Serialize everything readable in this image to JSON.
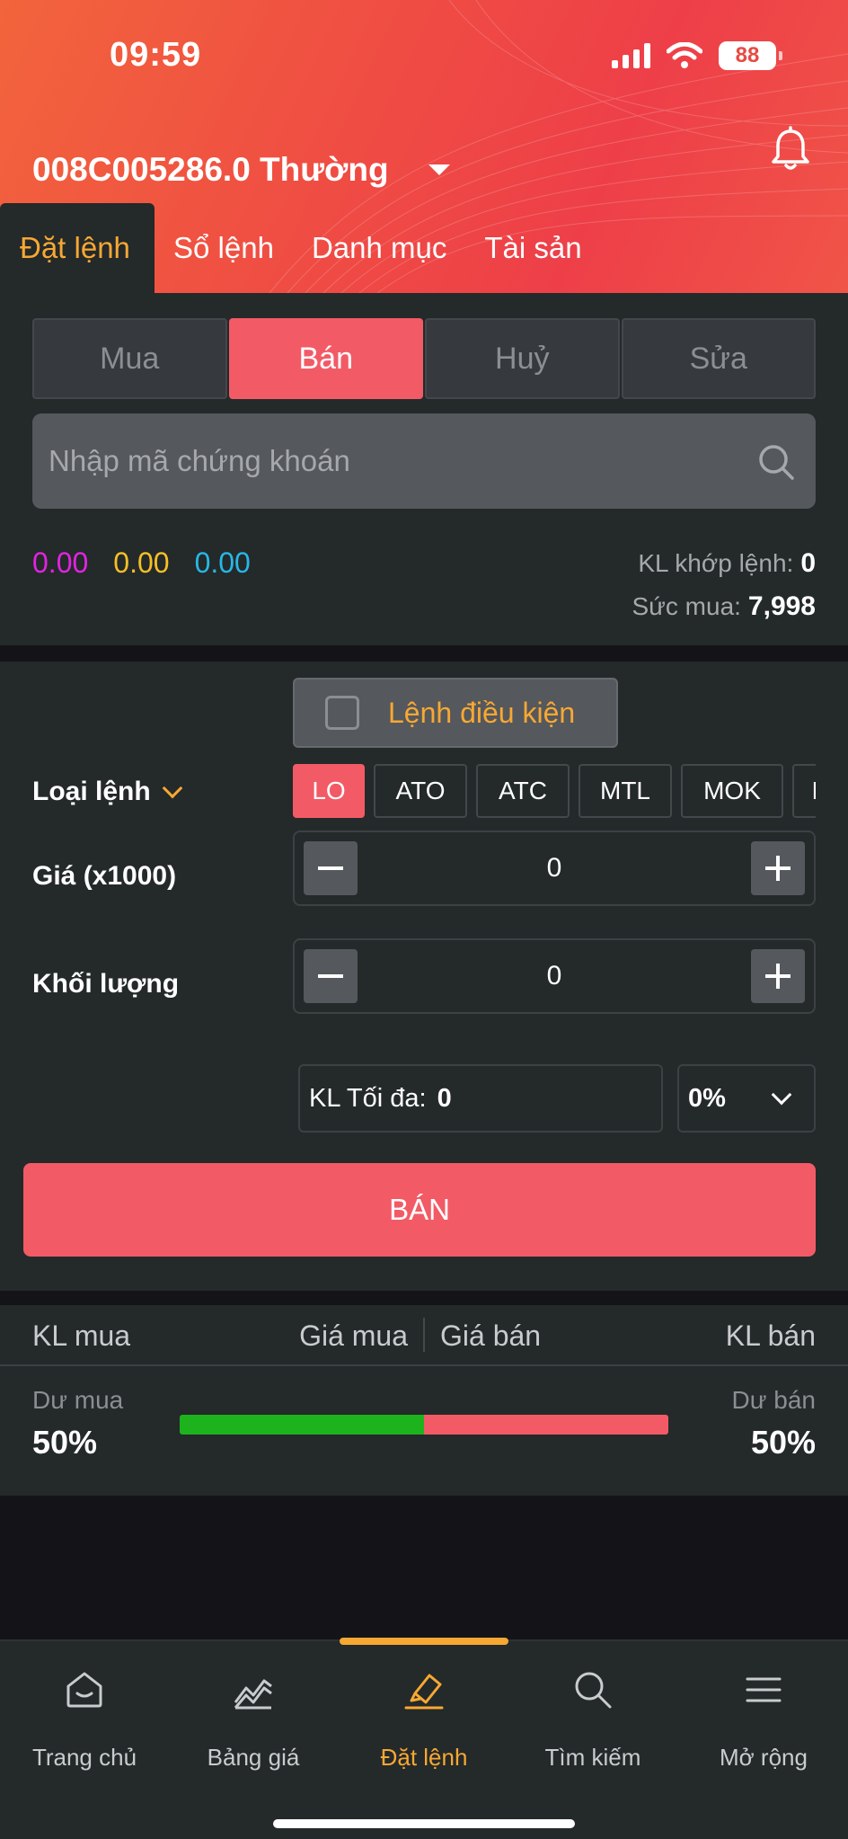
{
  "status_bar": {
    "time": "09:59",
    "battery": "88"
  },
  "account": {
    "label": "008C005286.0 Thường"
  },
  "tabs": [
    {
      "label": "Đặt lệnh",
      "active": true
    },
    {
      "label": "Sổ lệnh",
      "active": false
    },
    {
      "label": "Danh mục",
      "active": false
    },
    {
      "label": "Tài sản",
      "active": false
    }
  ],
  "order_sides": [
    {
      "label": "Mua",
      "active": false
    },
    {
      "label": "Bán",
      "active": true
    },
    {
      "label": "Huỷ",
      "active": false
    },
    {
      "label": "Sửa",
      "active": false
    }
  ],
  "search": {
    "placeholder": "Nhập mã chứng khoán"
  },
  "prices": [
    {
      "value": "0.00",
      "color": "#e024e0"
    },
    {
      "value": "0.00",
      "color": "#f5bf26"
    },
    {
      "value": "0.00",
      "color": "#26b8e6"
    }
  ],
  "matched_volume": {
    "label": "KL khớp lệnh:",
    "value": "0"
  },
  "buying_power": {
    "label": "Sức mua:",
    "value": "7,998"
  },
  "conditional_order": {
    "label": "Lệnh điều kiện",
    "checked": false
  },
  "order_type": {
    "label": "Loại lệnh",
    "options": [
      "LO",
      "ATO",
      "ATC",
      "MTL",
      "MOK",
      "MAK"
    ],
    "selected": "LO"
  },
  "price_field": {
    "label": "Giá (x1000)",
    "value": "0"
  },
  "quantity_field": {
    "label": "Khối lượng",
    "value": "0"
  },
  "max_quantity": {
    "label": "KL Tối đa:",
    "value": "0"
  },
  "percent_select": {
    "value": "0%"
  },
  "submit": {
    "label": "BÁN"
  },
  "orderbook": {
    "headers": [
      "KL mua",
      "Giá mua",
      "Giá bán",
      "KL bán"
    ],
    "buy_surplus_label": "Dư mua",
    "sell_surplus_label": "Dư bán",
    "buy_percent": "50%",
    "sell_percent": "50%",
    "buy_ratio": 0.5
  },
  "bottom_nav": [
    {
      "label": "Trang chủ",
      "icon": "home-icon",
      "active": false
    },
    {
      "label": "Bảng giá",
      "icon": "chart-icon",
      "active": false
    },
    {
      "label": "Đặt lệnh",
      "icon": "order-pen-icon",
      "active": true
    },
    {
      "label": "Tìm kiếm",
      "icon": "search-icon",
      "active": false
    },
    {
      "label": "Mở rộng",
      "icon": "menu-icon",
      "active": false
    }
  ],
  "colors": {
    "accent": "#f7a833",
    "sell": "#f25b66",
    "buy": "#1db31d",
    "panel": "#24292a"
  }
}
